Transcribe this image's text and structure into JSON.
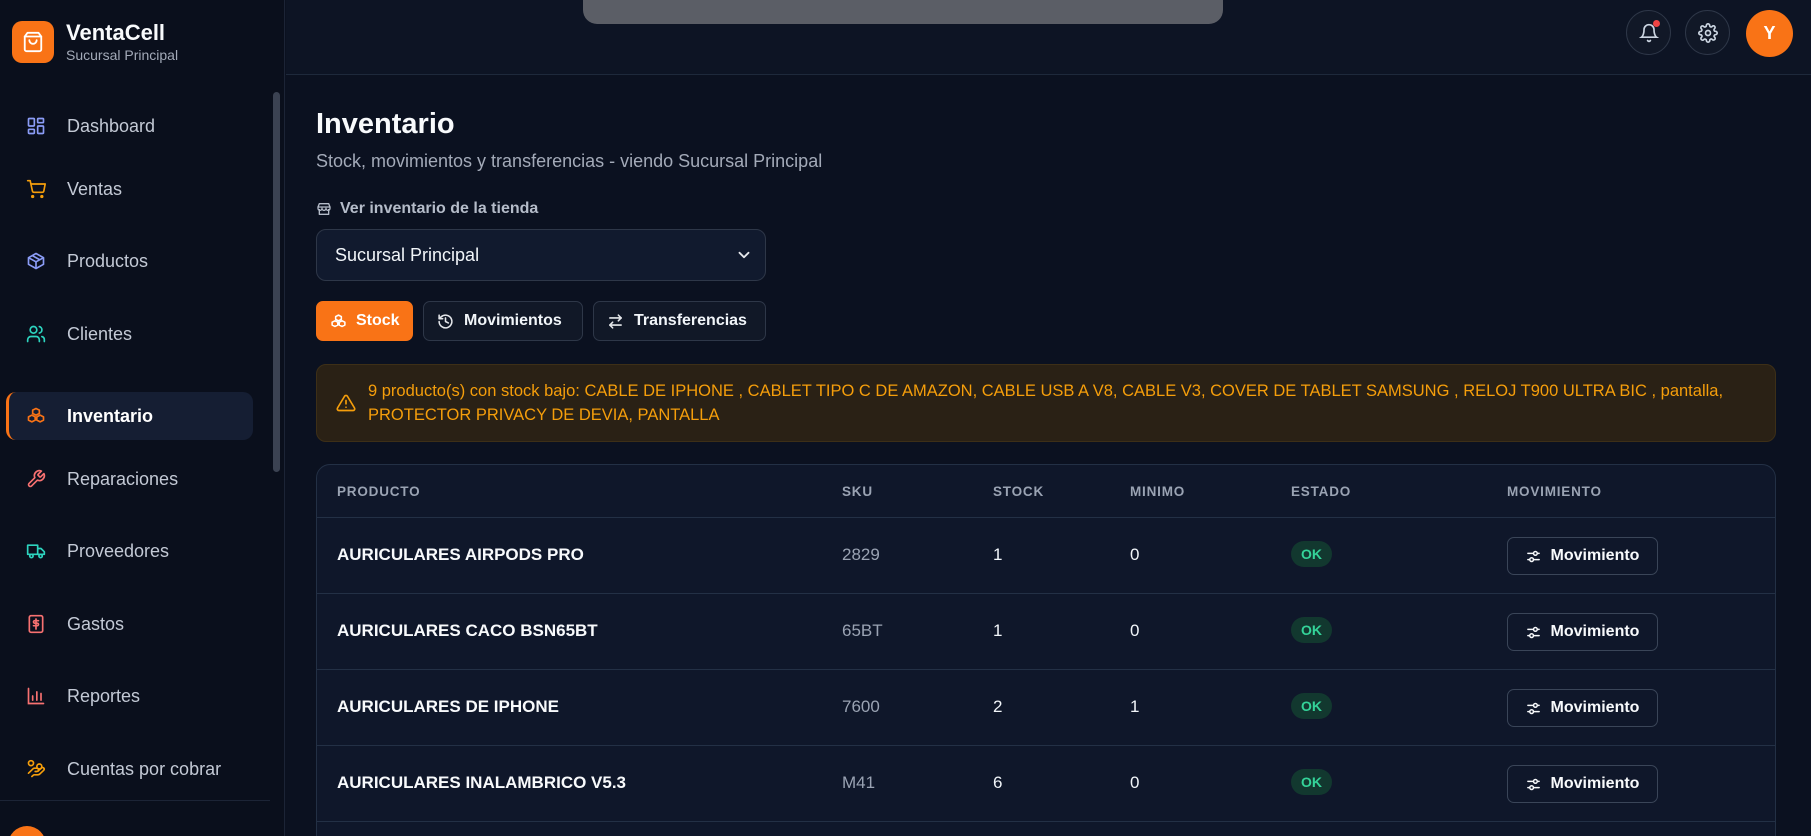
{
  "brand": {
    "name": "VentaCell",
    "subtitle": "Sucursal Principal"
  },
  "sidebar": {
    "items": [
      {
        "label": "Dashboard",
        "icon": "dashboard-icon",
        "color": "#8b9cf6"
      },
      {
        "label": "Ventas",
        "icon": "cart-icon",
        "color": "#f59e0b"
      },
      {
        "label": "Productos",
        "icon": "package-icon",
        "color": "#8b9cf6"
      },
      {
        "label": "Clientes",
        "icon": "users-icon",
        "color": "#2dd4bf"
      },
      {
        "label": "Inventario",
        "icon": "boxes-icon",
        "color": "#f97316",
        "active": true
      },
      {
        "label": "Reparaciones",
        "icon": "wrench-icon",
        "color": "#f87171"
      },
      {
        "label": "Proveedores",
        "icon": "truck-icon",
        "color": "#2dd4bf"
      },
      {
        "label": "Gastos",
        "icon": "receipt-icon",
        "color": "#f87171"
      },
      {
        "label": "Reportes",
        "icon": "bar-chart-icon",
        "color": "#f87171"
      },
      {
        "label": "Cuentas por cobrar",
        "icon": "hand-coins-icon",
        "color": "#f59e0b"
      }
    ]
  },
  "header": {
    "avatar_initial": "Y"
  },
  "page": {
    "title": "Inventario",
    "subtitle": "Stock, movimientos y transferencias - viendo Sucursal Principal",
    "store_label": "Ver inventario de la tienda",
    "store_selected": "Sucursal Principal",
    "tabs": [
      {
        "label": "Stock",
        "active": true
      },
      {
        "label": "Movimientos",
        "active": false
      },
      {
        "label": "Transferencias",
        "active": false
      }
    ],
    "alert": "9 producto(s) con stock bajo: CABLE DE IPHONE , CABLET TIPO C DE AMAZON, CABLE USB A V8, CABLE V3, COVER DE TABLET SAMSUNG , RELOJ T900 ULTRA BIC , pantalla, PROTECTOR PRIVACY DE DEVIA, PANTALLA"
  },
  "table": {
    "headers": [
      "PRODUCTO",
      "SKU",
      "STOCK",
      "MINIMO",
      "ESTADO",
      "MOVIMIENTO"
    ],
    "rows": [
      {
        "product": "AURICULARES AIRPODS PRO",
        "sku": "2829",
        "stock": "1",
        "min": "0",
        "status": "OK",
        "action": "Movimiento"
      },
      {
        "product": "AURICULARES CACO BSN65BT",
        "sku": "65BT",
        "stock": "1",
        "min": "0",
        "status": "OK",
        "action": "Movimiento"
      },
      {
        "product": "AURICULARES DE IPHONE",
        "sku": "7600",
        "stock": "2",
        "min": "1",
        "status": "OK",
        "action": "Movimiento"
      },
      {
        "product": "AURICULARES INALAMBRICO V5.3",
        "sku": "M41",
        "stock": "6",
        "min": "0",
        "status": "OK",
        "action": "Movimiento"
      }
    ]
  },
  "colors": {
    "accent": "#f97316",
    "ok": "#34d399",
    "warning": "#f59e0b"
  }
}
